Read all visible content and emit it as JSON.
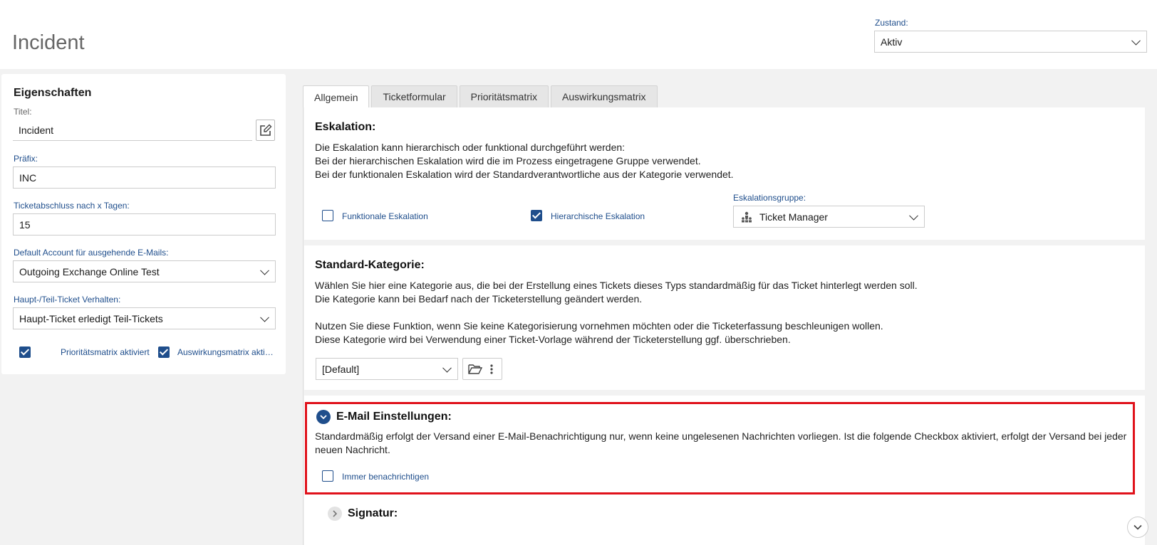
{
  "header": {
    "title": "Incident",
    "state_label": "Zustand:",
    "state_value": "Aktiv"
  },
  "properties": {
    "heading": "Eigenschaften",
    "title_label": "Titel:",
    "title_value": "Incident",
    "prefix_label": "Präfix:",
    "prefix_value": "INC",
    "close_label": "Ticketabschluss nach x Tagen:",
    "close_value": "15",
    "account_label": "Default Account für ausgehende E-Mails:",
    "account_value": "Outgoing Exchange Online Test",
    "parent_label": "Haupt-/Teil-Ticket Verhalten:",
    "parent_value": "Haupt-Ticket erledigt Teil-Tickets",
    "priority_matrix_label": "Prioritätsmatrix aktiviert",
    "priority_matrix_checked": true,
    "impact_matrix_label": "Auswirkungsmatrix aktiviert",
    "impact_matrix_checked": true
  },
  "tabs": [
    {
      "label": "Allgemein",
      "active": true
    },
    {
      "label": "Ticketformular",
      "active": false
    },
    {
      "label": "Prioritätsmatrix",
      "active": false
    },
    {
      "label": "Auswirkungsmatrix",
      "active": false
    }
  ],
  "escalation": {
    "title": "Eskalation:",
    "line1": "Die Eskalation kann hierarchisch oder funktional durchgeführt werden:",
    "line2": "Bei der hierarchischen Eskalation wird die im Prozess eingetragene Gruppe verwendet.",
    "line3": "Bei der funktionalen Eskalation wird der Standardverantwortliche aus der Kategorie verwendet.",
    "functional_label": "Funktionale Eskalation",
    "functional_checked": false,
    "hierarchical_label": "Hierarchische Eskalation",
    "hierarchical_checked": true,
    "group_label": "Eskalationsgruppe:",
    "group_value": "Ticket Manager"
  },
  "category": {
    "title": "Standard-Kategorie:",
    "line1": "Wählen Sie hier eine Kategorie aus, die bei der Erstellung eines Tickets dieses Typs standardmäßig für das Ticket hinterlegt werden soll.",
    "line2": "Die Kategorie kann bei Bedarf nach der Ticketerstellung geändert werden.",
    "line3": "Nutzen Sie diese Funktion, wenn Sie keine Kategorisierung vornehmen möchten oder die Ticketerfassung beschleunigen wollen.",
    "line4": "Diese Kategorie wird bei Verwendung einer Ticket-Vorlage während der Ticketerstellung ggf. überschrieben.",
    "value": "[Default]"
  },
  "email": {
    "title": "E-Mail Einstellungen:",
    "text": "Standardmäßig erfolgt der Versand einer E-Mail-Benachrichtigung nur, wenn keine ungelesenen Nachrichten vorliegen. Ist die folgende Checkbox aktiviert, erfolgt der Versand bei jeder neuen Nachricht.",
    "always_notify_label": "Immer benachrichtigen",
    "always_notify_checked": false
  },
  "signature": {
    "title": "Signatur:"
  },
  "colors": {
    "accent": "#1f4e8c",
    "highlight": "#e0121b"
  }
}
